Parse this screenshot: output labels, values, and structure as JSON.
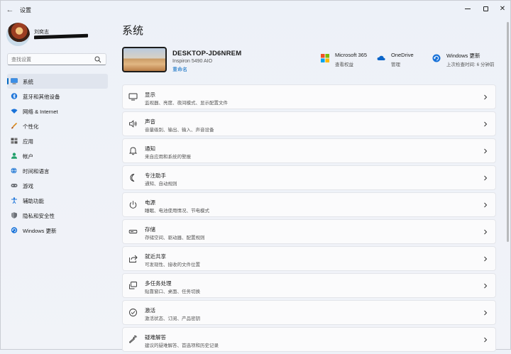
{
  "window": {
    "title": "设置"
  },
  "user": {
    "name": "刘奕志"
  },
  "search": {
    "placeholder": "查找设置"
  },
  "sidebar": {
    "items": [
      {
        "label": "系统",
        "icon": "monitor-icon",
        "active": true
      },
      {
        "label": "蓝牙和其他设备",
        "icon": "bluetooth-icon"
      },
      {
        "label": "网络 & Internet",
        "icon": "wifi-icon"
      },
      {
        "label": "个性化",
        "icon": "brush-icon"
      },
      {
        "label": "应用",
        "icon": "apps-icon"
      },
      {
        "label": "帐户",
        "icon": "person-icon"
      },
      {
        "label": "时间和语言",
        "icon": "globe-clock-icon"
      },
      {
        "label": "游戏",
        "icon": "gamepad-icon"
      },
      {
        "label": "辅助功能",
        "icon": "accessibility-icon"
      },
      {
        "label": "隐私和安全性",
        "icon": "shield-icon"
      },
      {
        "label": "Windows 更新",
        "icon": "update-icon"
      }
    ]
  },
  "main": {
    "title": "系统",
    "device": {
      "name": "DESKTOP-JD6NREM",
      "model": "Inspiron 5490 AIO",
      "rename": "重命名"
    },
    "quick": [
      {
        "title": "Microsoft 365",
        "sub": "查看权益",
        "icon": "microsoft-logo-icon"
      },
      {
        "title": "OneDrive",
        "sub": "管理",
        "icon": "cloud-icon"
      },
      {
        "title": "Windows 更新",
        "sub": "上次检查时间: 6 分钟前",
        "icon": "update-icon"
      }
    ],
    "cards": [
      {
        "title": "显示",
        "sub": "监视器、亮度、夜间模式、显示配置文件",
        "icon": "display-icon"
      },
      {
        "title": "声音",
        "sub": "音量级别、输出、输入、声音设备",
        "icon": "speaker-icon"
      },
      {
        "title": "通知",
        "sub": "来自应用和系统的警报",
        "icon": "bell-icon"
      },
      {
        "title": "专注助手",
        "sub": "通知、自动规则",
        "icon": "moon-icon"
      },
      {
        "title": "电源",
        "sub": "睡眠、电池使用情况、节电模式",
        "icon": "power-icon"
      },
      {
        "title": "存储",
        "sub": "存储空间、驱动器、配置规则",
        "icon": "storage-icon"
      },
      {
        "title": "就近共享",
        "sub": "可发现性、接收的文件位置",
        "icon": "share-icon"
      },
      {
        "title": "多任务处理",
        "sub": "贴靠窗口、桌面、任务切换",
        "icon": "multitask-icon"
      },
      {
        "title": "激活",
        "sub": "激活状态、订阅、产品密钥",
        "icon": "check-circle-icon"
      },
      {
        "title": "疑难解答",
        "sub": "建议的疑难解答、首选项和历史记录",
        "icon": "wrench-icon"
      }
    ]
  },
  "colors": {
    "accent": "#0067c0",
    "background": "#eef2f8",
    "card": "#fbfbfc"
  }
}
